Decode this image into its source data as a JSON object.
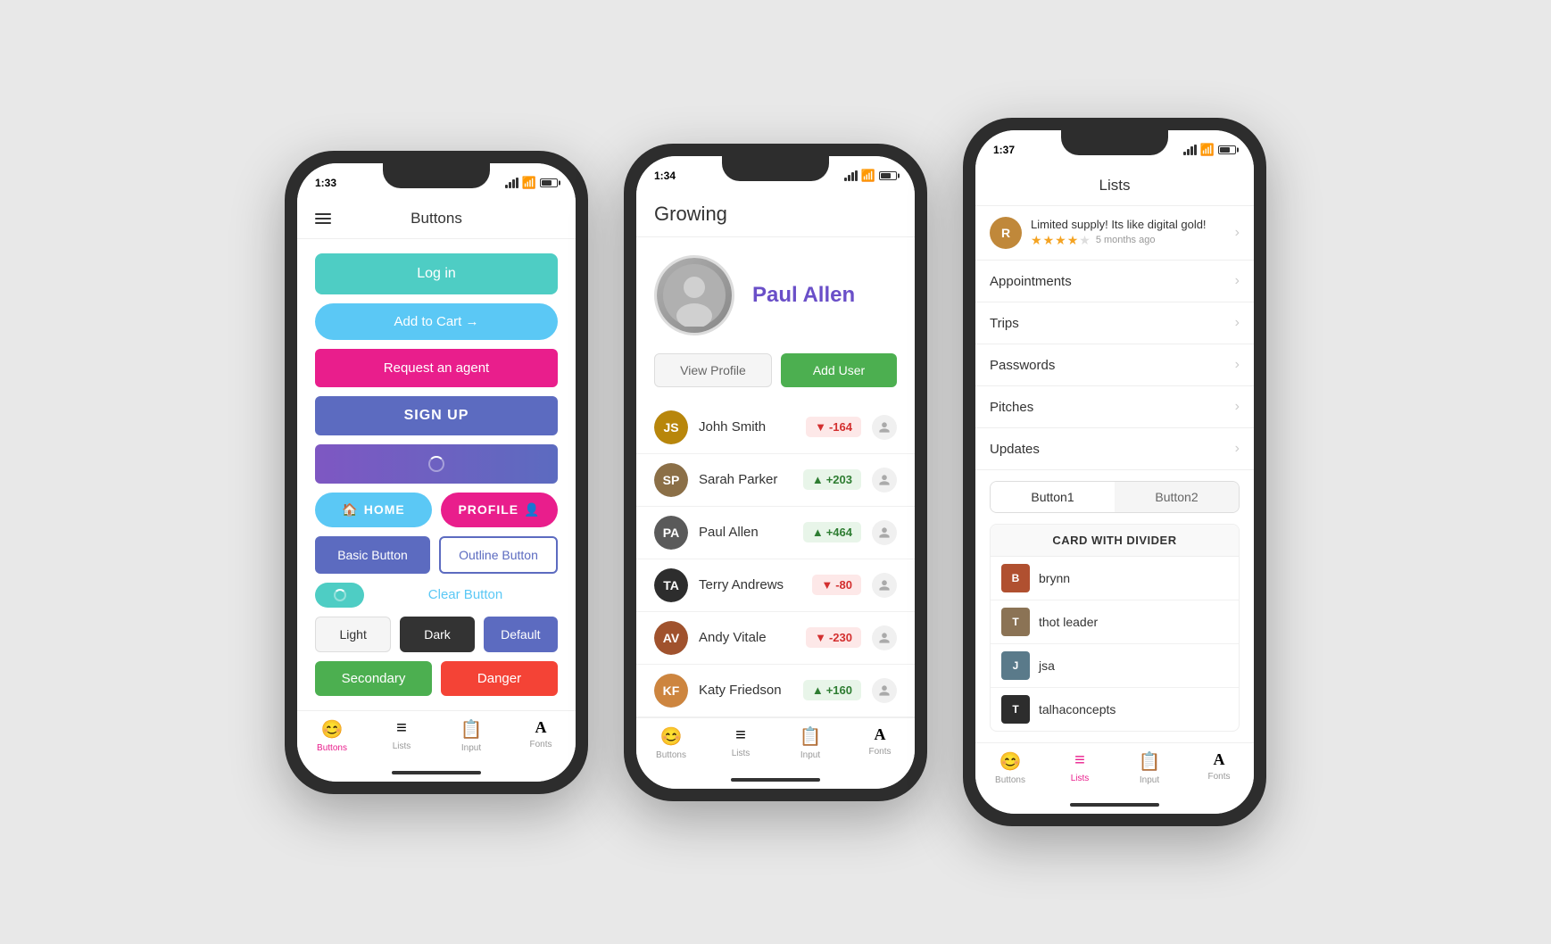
{
  "phone1": {
    "time": "1:33",
    "title": "Buttons",
    "buttons": {
      "login": "Log in",
      "cart": "Add to Cart →",
      "agent": "Request an agent",
      "signup": "SIGN UP",
      "home": "HOME",
      "profile": "PROFILE",
      "basic": "Basic Button",
      "outline": "Outline Button",
      "clear": "Clear Button",
      "light": "Light",
      "dark": "Dark",
      "default": "Default",
      "secondary": "Secondary",
      "danger": "Danger"
    },
    "tabs": {
      "buttons": "Buttons",
      "lists": "Lists",
      "input": "Input",
      "fonts": "Fonts"
    }
  },
  "phone2": {
    "time": "1:34",
    "app_title": "Growing",
    "profile": {
      "name": "Paul Allen"
    },
    "buttons": {
      "view_profile": "View Profile",
      "add_user": "Add User"
    },
    "users": [
      {
        "name": "Johh Smith",
        "score": "-164",
        "positive": false,
        "initials": "JS",
        "color": "#b8860b"
      },
      {
        "name": "Sarah Parker",
        "score": "+203",
        "positive": true,
        "initials": "SP",
        "color": "#8b6f47"
      },
      {
        "name": "Paul Allen",
        "score": "+464",
        "positive": true,
        "initials": "PA",
        "color": "#5a5a5a"
      },
      {
        "name": "Terry Andrews",
        "score": "-80",
        "positive": false,
        "initials": "TA",
        "color": "#2d2d2d"
      },
      {
        "name": "Andy Vitale",
        "score": "-230",
        "positive": false,
        "initials": "AV",
        "color": "#a0522d"
      },
      {
        "name": "Katy Friedson",
        "score": "+160",
        "positive": true,
        "initials": "KF",
        "color": "#cd853f"
      }
    ],
    "tabs": {
      "buttons": "Buttons",
      "lists": "Lists",
      "input": "Input",
      "fonts": "Fonts"
    }
  },
  "phone3": {
    "time": "1:37",
    "title": "Lists",
    "review": {
      "text": "Limited supply! Its like digital gold!",
      "stars": 4,
      "time": "5 months ago"
    },
    "menu_items": [
      "Appointments",
      "Trips",
      "Passwords",
      "Pitches",
      "Updates"
    ],
    "segmented": {
      "btn1": "Button1",
      "btn2": "Button2"
    },
    "card": {
      "title": "CARD WITH DIVIDER",
      "items": [
        {
          "name": "brynn",
          "color": "#b05030"
        },
        {
          "name": "thot leader",
          "color": "#8b7355"
        },
        {
          "name": "jsa",
          "color": "#5a7a8a"
        },
        {
          "name": "talhaconcepts",
          "color": "#2d2d2d"
        }
      ]
    },
    "tabs": {
      "buttons": "Buttons",
      "lists": "Lists",
      "input": "Input",
      "fonts": "Fonts"
    }
  }
}
